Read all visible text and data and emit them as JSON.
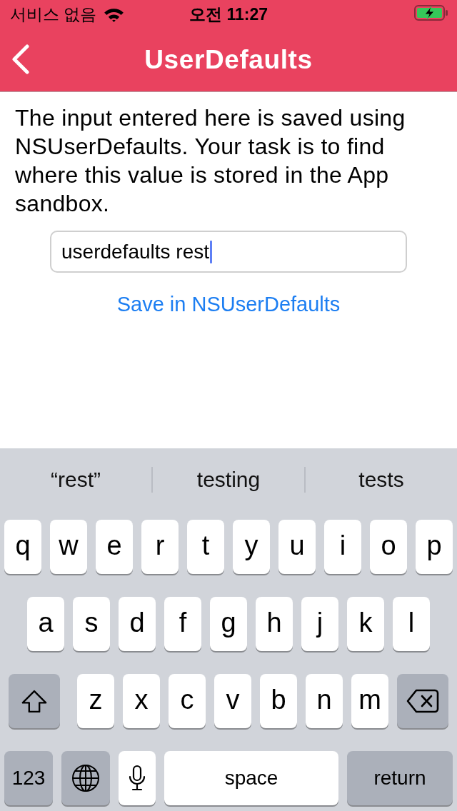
{
  "status_bar": {
    "carrier": "서비스 없음",
    "time": "오전 11:27",
    "battery": {
      "charging": true
    }
  },
  "nav_bar": {
    "title": "UserDefaults"
  },
  "description": "The input entered here is saved using NSUserDefaults. Your task is to find where this value is stored in the App sandbox.",
  "text_field": {
    "value": "userdefaults rest",
    "focused": true
  },
  "save_button": {
    "label": "Save in NSUserDefaults"
  },
  "keyboard": {
    "suggestions": [
      "“rest”",
      "testing",
      "tests"
    ],
    "rows": [
      {
        "keys": [
          {
            "kind": "letter",
            "label": "q"
          },
          {
            "kind": "letter",
            "label": "w"
          },
          {
            "kind": "letter",
            "label": "e"
          },
          {
            "kind": "letter",
            "label": "r"
          },
          {
            "kind": "letter",
            "label": "t"
          },
          {
            "kind": "letter",
            "label": "y"
          },
          {
            "kind": "letter",
            "label": "u"
          },
          {
            "kind": "letter",
            "label": "i"
          },
          {
            "kind": "letter",
            "label": "o"
          },
          {
            "kind": "letter",
            "label": "p"
          }
        ]
      },
      {
        "keys": [
          {
            "kind": "letter",
            "label": "a"
          },
          {
            "kind": "letter",
            "label": "s"
          },
          {
            "kind": "letter",
            "label": "d"
          },
          {
            "kind": "letter",
            "label": "f"
          },
          {
            "kind": "letter",
            "label": "g"
          },
          {
            "kind": "letter",
            "label": "h"
          },
          {
            "kind": "letter",
            "label": "j"
          },
          {
            "kind": "letter",
            "label": "k"
          },
          {
            "kind": "letter",
            "label": "l"
          }
        ]
      },
      {
        "keys": [
          {
            "kind": "shift"
          },
          {
            "kind": "letter",
            "label": "z"
          },
          {
            "kind": "letter",
            "label": "x"
          },
          {
            "kind": "letter",
            "label": "c"
          },
          {
            "kind": "letter",
            "label": "v"
          },
          {
            "kind": "letter",
            "label": "b"
          },
          {
            "kind": "letter",
            "label": "n"
          },
          {
            "kind": "letter",
            "label": "m"
          },
          {
            "kind": "delete"
          }
        ]
      },
      {
        "keys": [
          {
            "kind": "numbers",
            "label": "123"
          },
          {
            "kind": "globe"
          },
          {
            "kind": "mic"
          },
          {
            "kind": "space",
            "label": "space"
          },
          {
            "kind": "return",
            "label": "return"
          }
        ]
      }
    ]
  }
}
